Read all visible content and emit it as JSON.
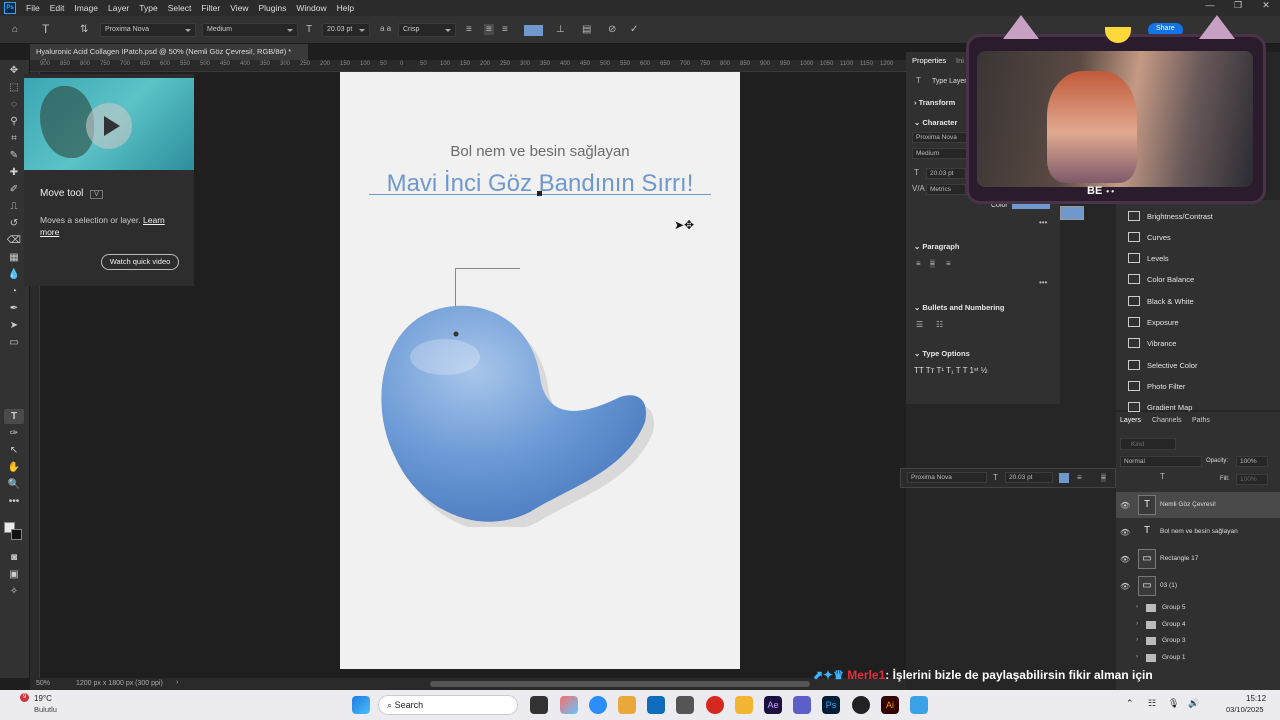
{
  "app": {
    "name": "Ps",
    "colors": {
      "accent": "#31a8ff",
      "text_blue": "#6f99cc",
      "drop_blue": "#6b9ad6"
    }
  },
  "menu": [
    "File",
    "Edit",
    "Image",
    "Layer",
    "Type",
    "Select",
    "Filter",
    "View",
    "Plugins",
    "Window",
    "Help"
  ],
  "share": {
    "label": "Share"
  },
  "options": {
    "font_family": "Proxima Nova",
    "font_style": "Medium",
    "font_size": "20.03 pt",
    "antialias": "Crisp",
    "aa_label": "a a"
  },
  "document": {
    "tab_title": "Hyaluronic Acid Collagen IPatch.psd @ 50% (Nemli Göz Çevresi!, RGB/8#) *",
    "close": "×",
    "subtitle": "Bol nem ve besin sağlayan",
    "title": "Mavi İnci Göz Bandının Sırrı!"
  },
  "ruler": {
    "ticks": [
      "900",
      "850",
      "800",
      "750",
      "700",
      "650",
      "600",
      "550",
      "500",
      "450",
      "400",
      "350",
      "300",
      "250",
      "200",
      "150",
      "100",
      "50",
      "0",
      "50",
      "100",
      "150",
      "200",
      "250",
      "300",
      "350",
      "400",
      "450",
      "500",
      "550",
      "600",
      "650",
      "700",
      "750",
      "800",
      "850",
      "900",
      "950",
      "1000",
      "1050",
      "1100",
      "1150",
      "1200"
    ]
  },
  "learn": {
    "title": "Move tool",
    "shortcut": "V",
    "desc": "Moves a selection or layer.",
    "link": "Learn more",
    "video_button": "Watch quick video"
  },
  "statusbar": {
    "zoom": "50%",
    "doc_info": "1200 px x 1800 px (300 ppi)",
    "arrow": "›"
  },
  "properties": {
    "tabs": [
      "Properties",
      "Ini"
    ],
    "layer_type": "Type Layer",
    "sections": {
      "transform": "Transform",
      "character": "Character",
      "paragraph": "Paragraph",
      "bullets": "Bullets and Numbering",
      "type_options": "Type Options"
    },
    "character": {
      "font": "Proxima Nova",
      "style": "Medium",
      "size": "20.03 pt",
      "kerning": "Metrics",
      "color_label": "Color"
    },
    "type_buttons": "TT Tт T¹ T₁ T T 1ˢᵗ ½",
    "more": "•••"
  },
  "adjustments": [
    "Brightness/Contrast",
    "Curves",
    "Levels",
    "Color Balance",
    "Black & White",
    "Exposure",
    "Vibrance",
    "Selective Color",
    "Photo Filter",
    "Gradient Map"
  ],
  "layers": {
    "tabs": [
      "Layers",
      "Channels",
      "Paths"
    ],
    "search_placeholder": "Kind",
    "blend_mode": "Normal",
    "opacity_label": "Opacity:",
    "opacity": "100%",
    "fill_label": "Fill:",
    "fill": "100%",
    "items": [
      {
        "name": "Nemli Göz Çevresi!",
        "thumb": "T"
      },
      {
        "name": "Bol nem ve besin sağlayan",
        "thumb": "T"
      },
      {
        "name": "Rectangle 17",
        "thumb": "▭"
      },
      {
        "name": "03 (1)",
        "thumb": "▭"
      }
    ],
    "groups": [
      "Group 5",
      "Group 4",
      "Group 3",
      "Group 1"
    ]
  },
  "floatbar": {
    "font": "Proxima Nova",
    "size": "20.03 pt"
  },
  "webcam": {
    "logo": "BE",
    "dots": "• •"
  },
  "chat": {
    "user": "Merle1",
    "message": ": İşlerini bizle de paylaşabilirsin fikir alman için"
  },
  "taskbar": {
    "weather_temp": "19°C",
    "weather_desc": "Bulutlu",
    "badge": "9",
    "search": "Search",
    "time": "15:12",
    "date": "03/10/2025",
    "apps": [
      "Ae",
      "Ps",
      "Ai"
    ]
  }
}
